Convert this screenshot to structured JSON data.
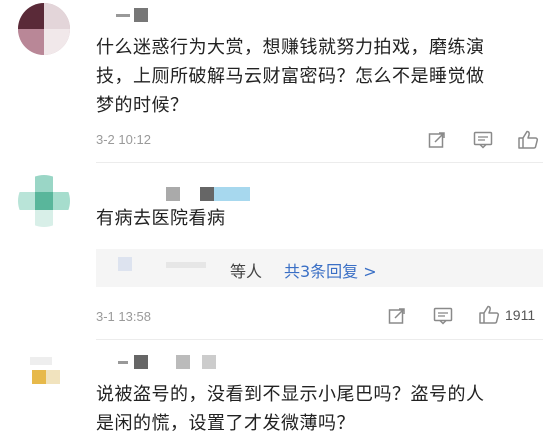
{
  "comments": [
    {
      "text_lines": [
        "什么迷惑行为大赏，想赚钱就努力拍戏，磨练演",
        "技，上厕所破解马云财富密码？怎么不是睡觉做",
        "梦的时候？"
      ],
      "timestamp": "3-2 10:12",
      "like_count": ""
    },
    {
      "text_lines": [
        "有病去医院看病"
      ],
      "reply_prefix": "等人",
      "reply_link": "共3条回复 >",
      "timestamp": "3-1 13:58",
      "like_count": "1911"
    },
    {
      "text_lines": [
        "说被盗号的，没看到不显示小尾巴吗？盗号的人",
        "是闲的慌，设置了才发微薄吗？"
      ]
    }
  ],
  "icons": [
    "share-icon",
    "comment-icon",
    "like-icon"
  ]
}
